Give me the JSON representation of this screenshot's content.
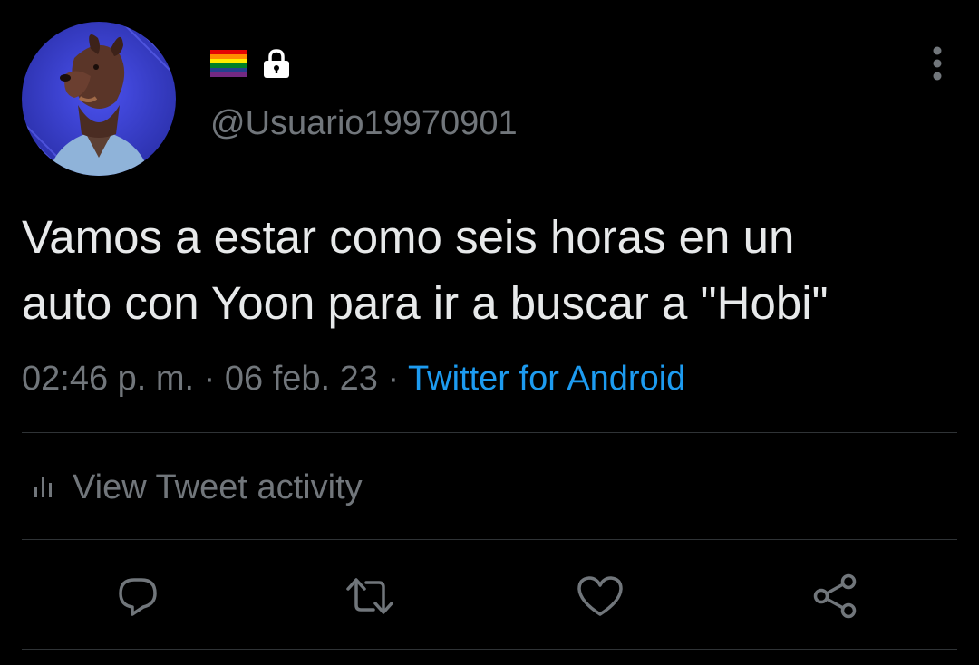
{
  "tweet": {
    "author": {
      "display_name_icons": [
        "rainbow-flag-icon",
        "lock-icon"
      ],
      "handle": "@Usuario19970901"
    },
    "text_lines": [
      "Vamos a estar como seis horas en un",
      "auto con Yoon para ir a buscar a \"Hobi\""
    ],
    "meta": {
      "time": "02:46 p. m.",
      "separator": " · ",
      "date": "06 feb. 23",
      "source": "Twitter for Android"
    },
    "activity_label": "View Tweet activity",
    "actions": [
      "reply-icon",
      "retweet-icon",
      "like-icon",
      "share-icon"
    ]
  },
  "colors": {
    "background": "#000000",
    "text": "#e7e9ea",
    "secondary": "#71767b",
    "link": "#1d9bf0",
    "divider": "#2f3336",
    "avatar_bg": "#3a3fd6"
  }
}
